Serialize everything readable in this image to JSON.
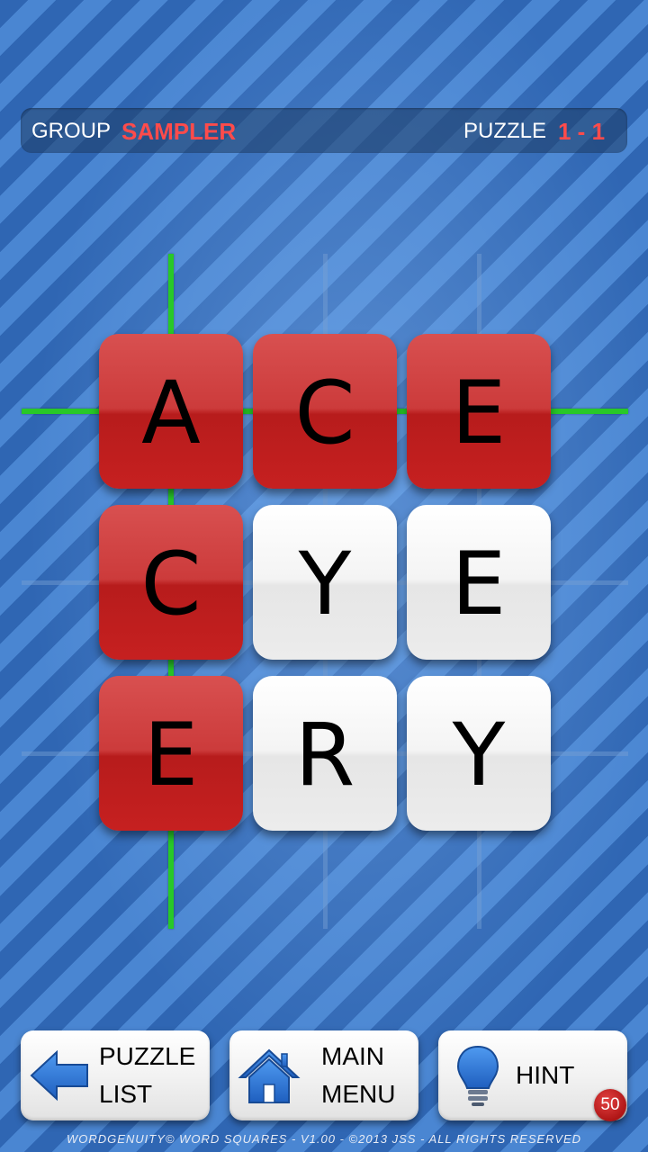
{
  "header": {
    "group_label": "GROUP",
    "group_value": "SAMPLER",
    "puzzle_label": "PUZZLE",
    "puzzle_value": "1 - 1"
  },
  "board": {
    "rows": [
      [
        {
          "letter": "A",
          "state": "red"
        },
        {
          "letter": "C",
          "state": "red"
        },
        {
          "letter": "E",
          "state": "red"
        }
      ],
      [
        {
          "letter": "C",
          "state": "red"
        },
        {
          "letter": "Y",
          "state": "white"
        },
        {
          "letter": "E",
          "state": "white"
        }
      ],
      [
        {
          "letter": "E",
          "state": "red"
        },
        {
          "letter": "R",
          "state": "white"
        },
        {
          "letter": "Y",
          "state": "white"
        }
      ]
    ]
  },
  "buttons": {
    "puzzle_list": {
      "line1": "PUZZLE",
      "line2": "LIST",
      "icon": "arrow-left-icon"
    },
    "main_menu": {
      "line1": "MAIN",
      "line2": "MENU",
      "icon": "home-icon"
    },
    "hint": {
      "label": "HINT",
      "icon": "lightbulb-icon",
      "count": "50"
    }
  },
  "footer": {
    "text": "WORDGENUITY© WORD SQUARES - V1.00 - ©2013 JSS - ALL RIGHTS RESERVED"
  },
  "colors": {
    "accent_red": "#ff4b4b",
    "tile_red": "#c62828",
    "guide_green": "#28c828",
    "background_blue": "#3f7cc8"
  }
}
